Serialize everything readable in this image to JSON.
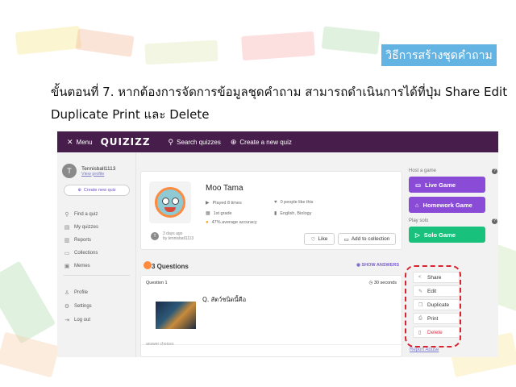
{
  "slide": {
    "title_tag": "วิธีการสร้างชุดคำถาม",
    "instruction_line1": "ขั้นตอนที่ 7. หากต้องการจัดการข้อมูลชุดคำถาม สามารถดำเนินการได้ที่ปุ่ม Share Edit",
    "instruction_line2": "Duplicate Print และ Delete"
  },
  "topbar": {
    "menu_label": "Menu",
    "logo": "QUIZIZZ",
    "search_label": "Search quizzes",
    "create_label": "Create a new quiz"
  },
  "sidebar": {
    "avatar_letter": "T",
    "username": "Tennisball1113",
    "view_profile": "View profile",
    "create_quiz": "Create new quiz",
    "items": [
      {
        "label": "Find a quiz",
        "icon": "search-icon"
      },
      {
        "label": "My quizzes",
        "icon": "document-icon"
      },
      {
        "label": "Reports",
        "icon": "chart-icon"
      },
      {
        "label": "Collections",
        "icon": "folder-icon"
      },
      {
        "label": "Memes",
        "icon": "image-icon"
      },
      {
        "label": "Profile",
        "icon": "user-icon"
      },
      {
        "label": "Settings",
        "icon": "gear-icon"
      },
      {
        "label": "Log out",
        "icon": "logout-icon"
      }
    ]
  },
  "quiz": {
    "name": "Moo Tama",
    "played": "Played 8 times",
    "likes": "0 people like this",
    "grade": "1st grade",
    "subjects": "English, Biology",
    "accuracy": "47% average accuracy",
    "author_time": "3 days ago",
    "author_by": "by tennisball1113",
    "like_label": "Like",
    "collection_label": "Add to collection"
  },
  "questions": {
    "count_label": "3 Questions",
    "show_answers": "SHOW ANSWERS",
    "q1_number": "Question 1",
    "q1_time": "30 seconds",
    "q1_text": "Q. สัตว์ชนิดนี้คือ",
    "answer_choices": "answer choices"
  },
  "right_panel": {
    "host_label": "Host a game",
    "live_game": "Live Game",
    "homework_game": "Homework Game",
    "solo_label": "Play solo",
    "solo_game": "Solo Game",
    "help_glyph": "?"
  },
  "actions": {
    "share": "Share",
    "edit": "Edit",
    "duplicate": "Duplicate",
    "print": "Print",
    "delete": "Delete",
    "report": "Report Abuse"
  },
  "colors": {
    "topbar": "#471d4b",
    "purple_button": "#8a4bd6",
    "green_button": "#19c27c",
    "delete_red": "#d9334a",
    "highlight_dash": "#d9232e",
    "title_tag": "#63b3e3"
  }
}
